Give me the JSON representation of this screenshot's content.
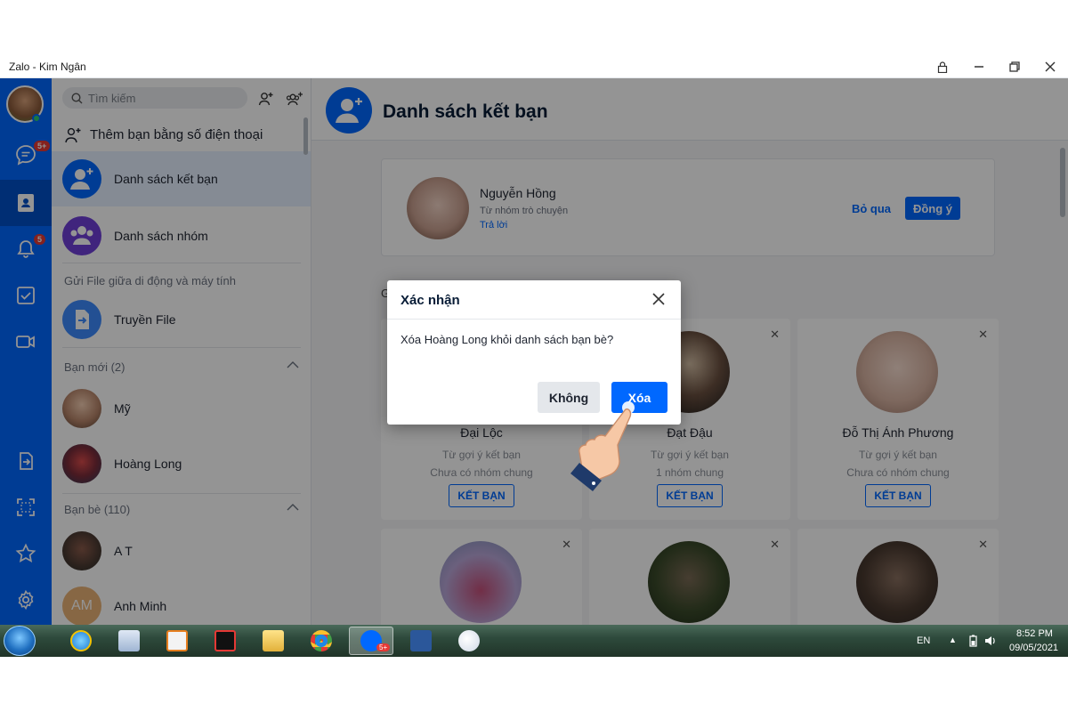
{
  "window": {
    "title": "Zalo - Kim Ngân"
  },
  "rail": {
    "badges": {
      "messages": "5+",
      "notifications": "5"
    }
  },
  "panel": {
    "search_placeholder": "Tìm kiếm",
    "add_by_phone": "Thêm bạn bằng số điện thoại",
    "friend_list": "Danh sách kết bạn",
    "group_list": "Danh sách nhóm",
    "file_section": "Gửi File giữa di động và máy tính",
    "transfer_file": "Truyền File",
    "new_friends_header": "Bạn mới (2)",
    "new_friends": [
      {
        "name": "Mỹ"
      },
      {
        "name": "Hoàng Long"
      }
    ],
    "friends_header": "Bạn bè (110)",
    "friends": [
      {
        "name": "A T"
      },
      {
        "name": "Anh Minh",
        "initials": "AM"
      }
    ]
  },
  "main": {
    "title": "Danh sách kết bạn",
    "request": {
      "name": "Nguyễn Hồng",
      "source": "Từ nhóm trò chuyện",
      "reply": "Trả lời",
      "skip": "Bỏ qua",
      "accept": "Đồng ý"
    },
    "section_letter": "G",
    "suggestions": [
      {
        "name": "Đại Lộc",
        "source": "Từ gợi ý kết bạn",
        "groups": "Chưa có nhóm chung",
        "action": "KẾT BẠN"
      },
      {
        "name": "Đạt Đậu",
        "source": "Từ gợi ý kết bạn",
        "groups": "1 nhóm chung",
        "action": "KẾT BẠN"
      },
      {
        "name": "Đỗ Thị Ánh Phương",
        "source": "Từ gợi ý kết bạn",
        "groups": "Chưa có nhóm chung",
        "action": "KẾT BẠN"
      }
    ]
  },
  "dialog": {
    "title": "Xác nhận",
    "message": "Xóa Hoàng Long khỏi danh sách bạn bè?",
    "cancel": "Không",
    "confirm": "Xóa"
  },
  "taskbar": {
    "language": "EN",
    "time": "8:52 PM",
    "date": "09/05/2021",
    "zalo_badge": "5+"
  },
  "colors": {
    "accent": "#0068ff",
    "rail": "#0068ff",
    "badge": "#e53935"
  }
}
